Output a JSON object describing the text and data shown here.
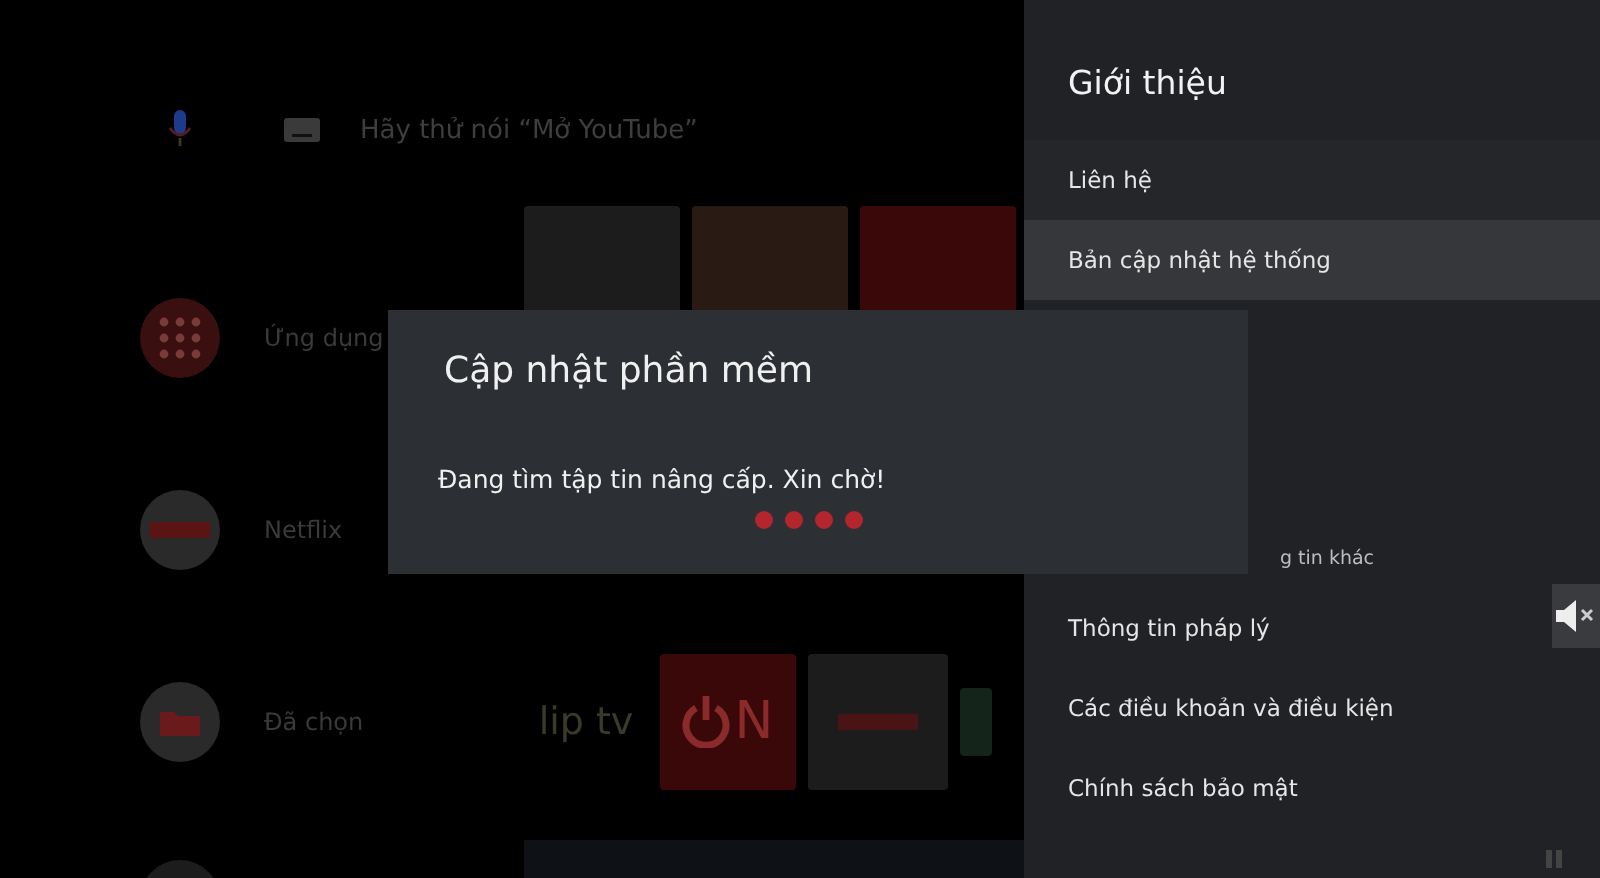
{
  "search": {
    "placeholder": "Hãy thử nói “Mở YouTube”"
  },
  "home_rows": [
    {
      "label": "Ứng dụng",
      "kind": "apps"
    },
    {
      "label": "Netflix",
      "kind": "netflix"
    },
    {
      "label": "Đã chọn",
      "kind": "picks"
    }
  ],
  "app_tiles": [
    {
      "kind": "text",
      "logo": "lip tv"
    },
    {
      "kind": "power",
      "logo": "N"
    },
    {
      "kind": "fpt"
    },
    {
      "kind": "plain"
    }
  ],
  "dialog": {
    "title": "Cập nhật phần mềm",
    "message": "Đang tìm tập tin nâng cấp. Xin chờ!"
  },
  "panel": {
    "title": "Giới thiệu",
    "items": [
      {
        "label": "Liên hệ",
        "selected": false,
        "kind": "row"
      },
      {
        "label": "Bản cập nhật hệ thống",
        "selected": true,
        "kind": "row"
      },
      {
        "label": "g tin khác",
        "selected": false,
        "kind": "covered"
      },
      {
        "label": "Thông tin pháp lý",
        "selected": false,
        "kind": "row"
      },
      {
        "label": "Các điều khoản và điều kiện",
        "selected": false,
        "kind": "row"
      },
      {
        "label": "Chính sách bảo mật",
        "selected": false,
        "kind": "row"
      }
    ]
  }
}
